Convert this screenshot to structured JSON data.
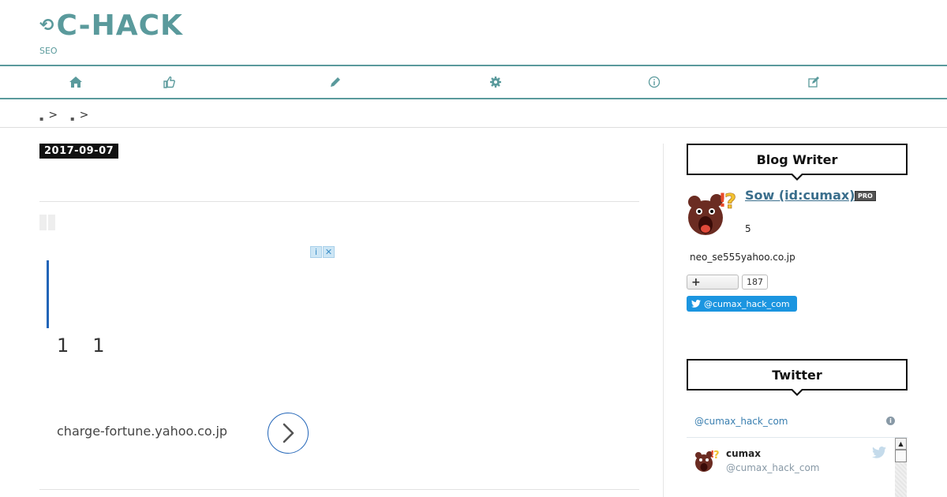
{
  "header": {
    "title": "C-HACK",
    "subtitle": "SEO"
  },
  "nav": {
    "items": [
      {
        "icon": "home-icon"
      },
      {
        "icon": "thumbs-up-icon"
      },
      {
        "icon": "pencil-icon"
      },
      {
        "icon": "gear-icon"
      },
      {
        "icon": "info-icon"
      },
      {
        "icon": "edit-icon"
      }
    ]
  },
  "breadcrumb": {
    "separator": ">"
  },
  "article": {
    "date": "2017-09-07",
    "numbers": [
      "1",
      "1"
    ],
    "ad": {
      "domain": "charge-fortune.yahoo.co.jp",
      "info_glyph": "i",
      "close_glyph": "✕"
    }
  },
  "sidebar": {
    "writer_widget": {
      "title": "Blog Writer",
      "name": "Sow (id:cumax)",
      "pro_label": "PRO",
      "count": "5",
      "email": "neo_se555yahoo.co.jp",
      "follow_plus": "+",
      "follower_count": "187",
      "twitter_follow_label": "@cumax_hack_com"
    },
    "twitter_widget": {
      "title": "Twitter",
      "header_handle": "@cumax_hack_com",
      "tweet": {
        "name": "cumax",
        "handle": "@cumax_hack_com"
      }
    }
  },
  "colors": {
    "accent": "#5a9a9c",
    "link": "#3a6e8c",
    "twitter_blue": "#1b95e0",
    "quote_bar": "#2265b8"
  }
}
